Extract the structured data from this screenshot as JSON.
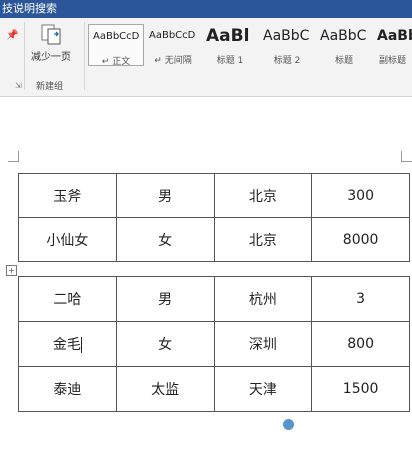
{
  "window": {
    "title": "技说明搜索"
  },
  "ribbon": {
    "reduce_button_label": "减少一页",
    "group_label": "新建组",
    "styles": [
      {
        "sample": "AaBbCcD",
        "name": "↵ 正文",
        "active": true
      },
      {
        "sample": "AaBbCcD",
        "name": "↵ 无间隔"
      },
      {
        "sample": "AaBl",
        "name": "标题 1"
      },
      {
        "sample": "AaBbC",
        "name": "标题 2"
      },
      {
        "sample": "AaBbC",
        "name": "标题"
      },
      {
        "sample": "AaBb",
        "name": "副标题"
      }
    ]
  },
  "table1": {
    "rows": [
      [
        "玉斧",
        "男",
        "北京",
        "300"
      ],
      [
        "小仙女",
        "女",
        "北京",
        "8000"
      ]
    ]
  },
  "table2": {
    "rows": [
      [
        "二哈",
        "男",
        "杭州",
        "3"
      ],
      [
        "金毛",
        "女",
        "深圳",
        "800"
      ],
      [
        "泰迪",
        "太监",
        "天津",
        "1500"
      ]
    ]
  },
  "icons": {
    "pin": "pin-icon",
    "reduce": "shrink-page-icon",
    "table_handle": "table-move-handle-icon"
  }
}
